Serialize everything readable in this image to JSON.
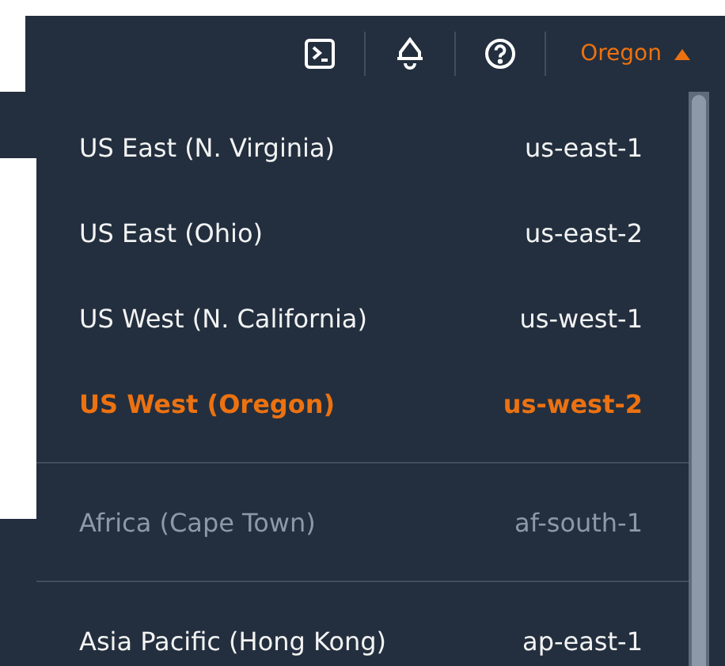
{
  "navbar": {
    "region_button": {
      "label": "Oregon",
      "expanded": true
    }
  },
  "region_menu": {
    "groups": [
      {
        "items": [
          {
            "name": "US East (N. Virginia)",
            "code": "us-east-1",
            "selected": false,
            "disabled": false
          },
          {
            "name": "US East (Ohio)",
            "code": "us-east-2",
            "selected": false,
            "disabled": false
          },
          {
            "name": "US West (N. California)",
            "code": "us-west-1",
            "selected": false,
            "disabled": false
          },
          {
            "name": "US West (Oregon)",
            "code": "us-west-2",
            "selected": true,
            "disabled": false
          }
        ]
      },
      {
        "items": [
          {
            "name": "Africa (Cape Town)",
            "code": "af-south-1",
            "selected": false,
            "disabled": true
          }
        ]
      },
      {
        "items": [
          {
            "name": "Asia Pacific (Hong Kong)",
            "code": "ap-east-1",
            "selected": false,
            "disabled": false
          }
        ]
      }
    ]
  }
}
